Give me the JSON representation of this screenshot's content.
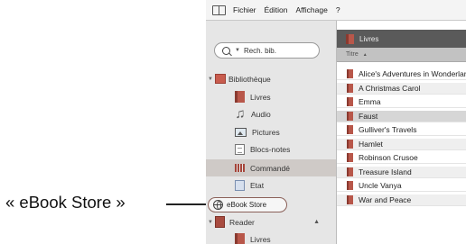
{
  "callout": {
    "label": "« eBook Store »"
  },
  "menubar": {
    "items": [
      "Fichier",
      "Édition",
      "Affichage",
      "?"
    ]
  },
  "sidebar": {
    "search_placeholder": "Rech. bib.",
    "library": {
      "label": "Bibliothèque",
      "icon": "library-icon"
    },
    "library_items": [
      {
        "label": "Livres",
        "icon": "book-icon"
      },
      {
        "label": "Audio",
        "icon": "music-note-icon"
      },
      {
        "label": "Pictures",
        "icon": "picture-icon"
      },
      {
        "label": "Blocs-notes",
        "icon": "notebook-icon"
      },
      {
        "label": "Commandé",
        "icon": "ordered-books-icon"
      },
      {
        "label": "Etat",
        "icon": "status-icon"
      }
    ],
    "ebook_store": {
      "label": "eBook Store",
      "icon": "globe-icon"
    },
    "reader": {
      "label": "Reader",
      "icon": "reader-device-icon"
    },
    "reader_items": [
      {
        "label": "Livres",
        "icon": "book-icon"
      }
    ]
  },
  "content": {
    "header_label": "Livres",
    "column_title": "Titre",
    "books": [
      "Alice's Adventures in Wonderland",
      "A Christmas Carol",
      "Emma",
      "Faust",
      "Gulliver's Travels",
      "Hamlet",
      "Robinson Crusoe",
      "Treasure Island",
      "Uncle Vanya",
      "War and Peace"
    ],
    "selected": "Faust"
  },
  "colors": {
    "accent": "#b8574a",
    "selection": "#d6d6d6",
    "header": "#5a5a5a"
  }
}
